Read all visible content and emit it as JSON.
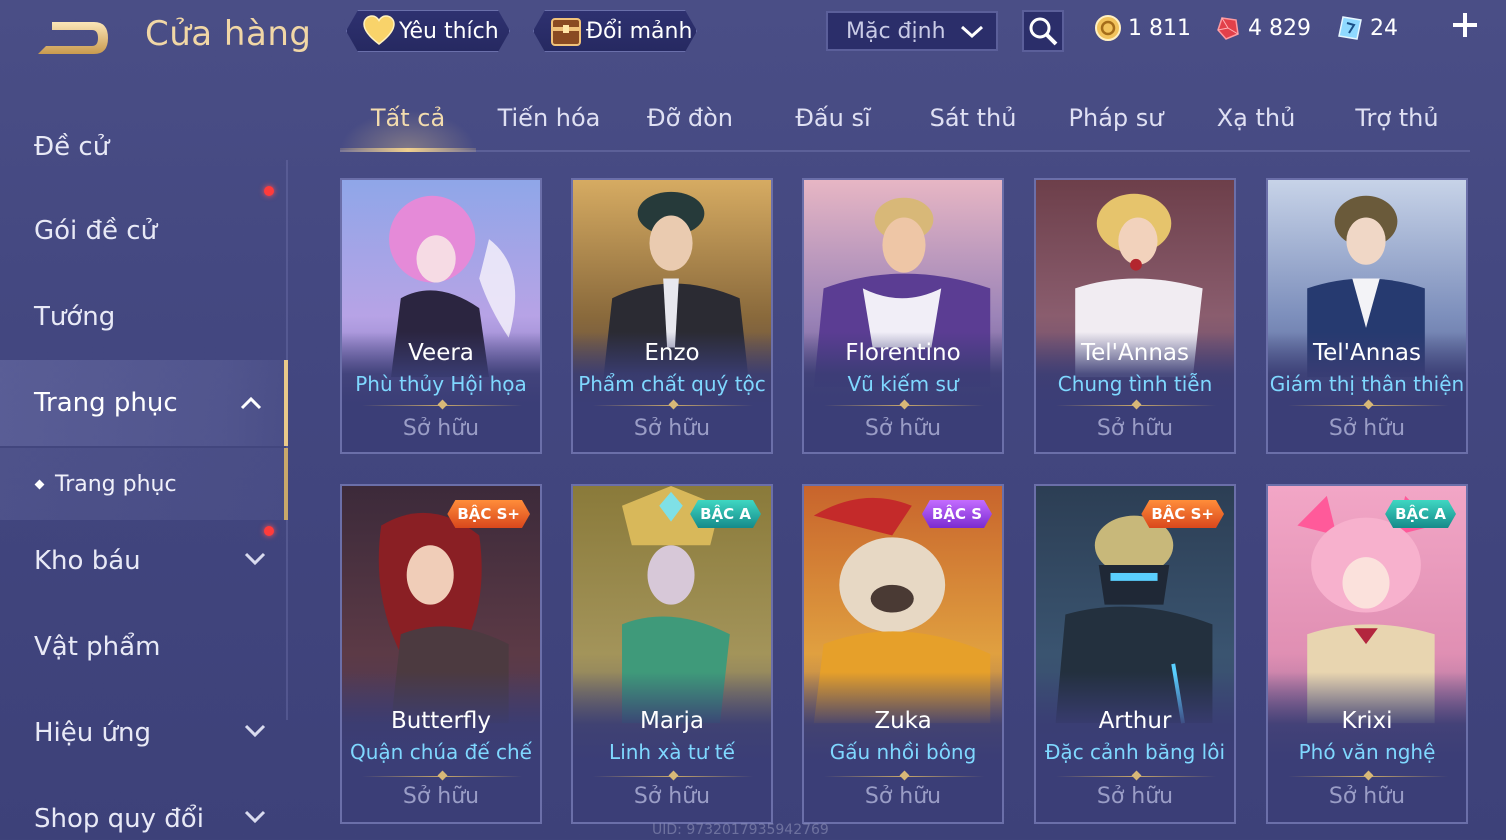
{
  "header": {
    "title": "Cửa hàng",
    "favorites_label": "Yêu thích",
    "exchange_label": "Đổi mảnh",
    "sort_value": "Mặc định",
    "gold": "1 811",
    "ruby": "4 829",
    "voucher": "24"
  },
  "sidebar": {
    "items": [
      {
        "label": "Đề cử"
      },
      {
        "label": "Gói đề cử"
      },
      {
        "label": "Tướng"
      },
      {
        "label": "Trang phục"
      },
      {
        "label": "Trang phục"
      },
      {
        "label": "Kho báu"
      },
      {
        "label": "Vật phẩm"
      },
      {
        "label": "Hiệu ứng"
      },
      {
        "label": "Shop quy đổi"
      }
    ]
  },
  "tabs": [
    "Tất cả",
    "Tiến hóa",
    "Đỡ đòn",
    "Đấu sĩ",
    "Sát thủ",
    "Pháp sư",
    "Xạ thủ",
    "Trợ thủ"
  ],
  "cards": [
    {
      "hero": "Veera",
      "skin": "Phù thủy Hội họa",
      "status": "Sở hữu",
      "tier": ""
    },
    {
      "hero": "Enzo",
      "skin": "Phẩm chất quý tộc",
      "status": "Sở hữu",
      "tier": ""
    },
    {
      "hero": "Florentino",
      "skin": "Vũ kiếm sư",
      "status": "Sở hữu",
      "tier": ""
    },
    {
      "hero": "Tel'Annas",
      "skin": "Chung tình tiễn",
      "status": "Sở hữu",
      "tier": ""
    },
    {
      "hero": "Tel'Annas",
      "skin": "Giám thị thân thiện",
      "status": "Sở hữu",
      "tier": ""
    },
    {
      "hero": "Butterfly",
      "skin": "Quận chúa đế chế",
      "status": "Sở hữu",
      "tier": "BẬC S+"
    },
    {
      "hero": "Marja",
      "skin": "Linh xà tư tế",
      "status": "Sở hữu",
      "tier": "BẬC A"
    },
    {
      "hero": "Zuka",
      "skin": "Gấu nhồi bông",
      "status": "Sở hữu",
      "tier": "BẬC S"
    },
    {
      "hero": "Arthur",
      "skin": "Đặc cảnh băng lôi",
      "status": "Sở hữu",
      "tier": "BẬC S+"
    },
    {
      "hero": "Krixi",
      "skin": "Phó văn nghệ",
      "status": "Sở hữu",
      "tier": "BẬC A"
    }
  ],
  "footer": {
    "uid": "UID: 9732017935942769"
  },
  "colors": {
    "accent_gold": "#f1d7a6",
    "skin_name": "#7fd8ff",
    "tier_splus": "#e85f26",
    "tier_a": "#21a89f",
    "tier_s": "#9a46e6",
    "notify": "#ff3b3b"
  }
}
